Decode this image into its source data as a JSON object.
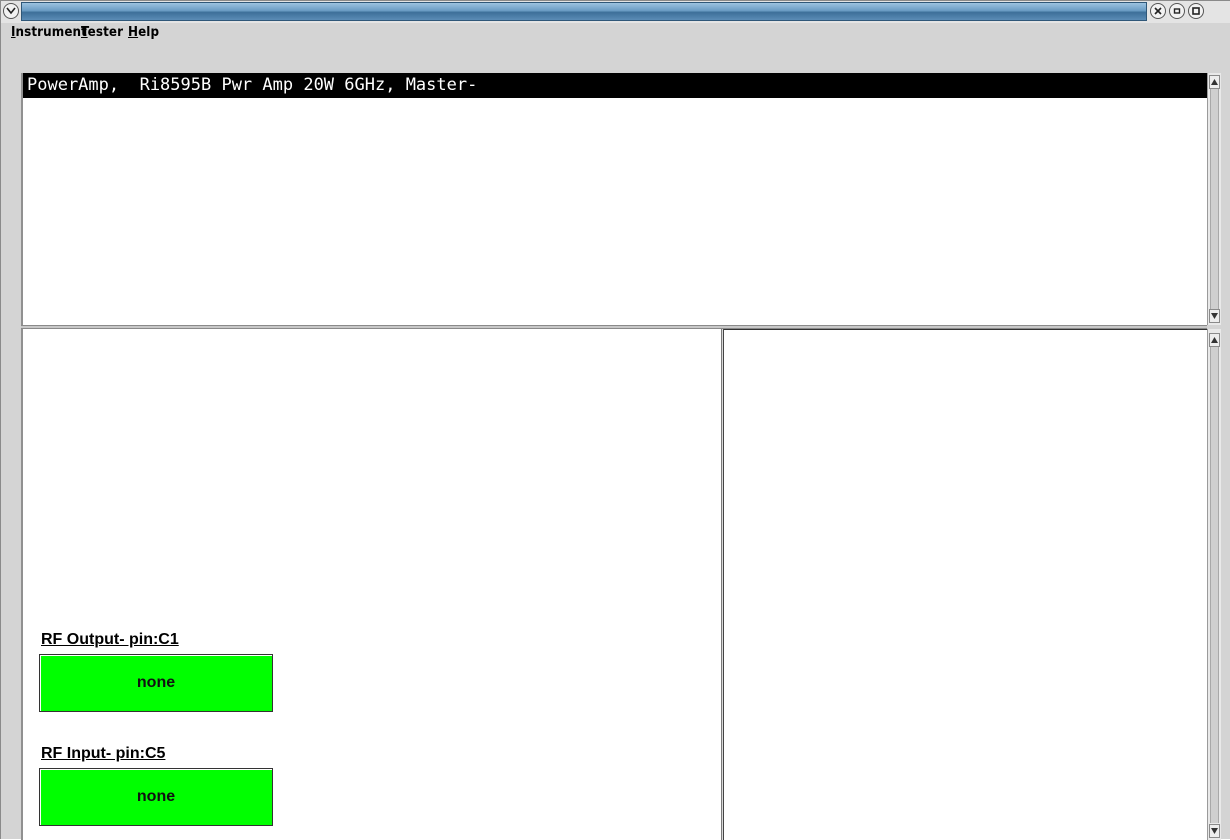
{
  "menubar": {
    "items": [
      {
        "label": "Instrument",
        "mnemonic": "I"
      },
      {
        "label": "Tester",
        "mnemonic": "T"
      },
      {
        "label": "Help",
        "mnemonic": "H"
      }
    ]
  },
  "log": {
    "lines": [
      "PowerAmp,  Ri8595B Pwr Amp 20W 6GHz, Master-"
    ]
  },
  "pins": [
    {
      "label": "RF Output- pin:C1",
      "value": "none",
      "color": "#00ff00"
    },
    {
      "label": "RF Input- pin:C5",
      "value": "none",
      "color": "#00ff00"
    }
  ],
  "colors": {
    "title_gradient": "#6b9cc4",
    "highlight_bg": "#000000",
    "highlight_fg": "#ffffff",
    "status_ok": "#00ff00"
  },
  "icons": {
    "window_menu": "chevron-down-icon",
    "close": "close-icon",
    "minimize": "minimize-icon",
    "maximize": "maximize-icon"
  }
}
